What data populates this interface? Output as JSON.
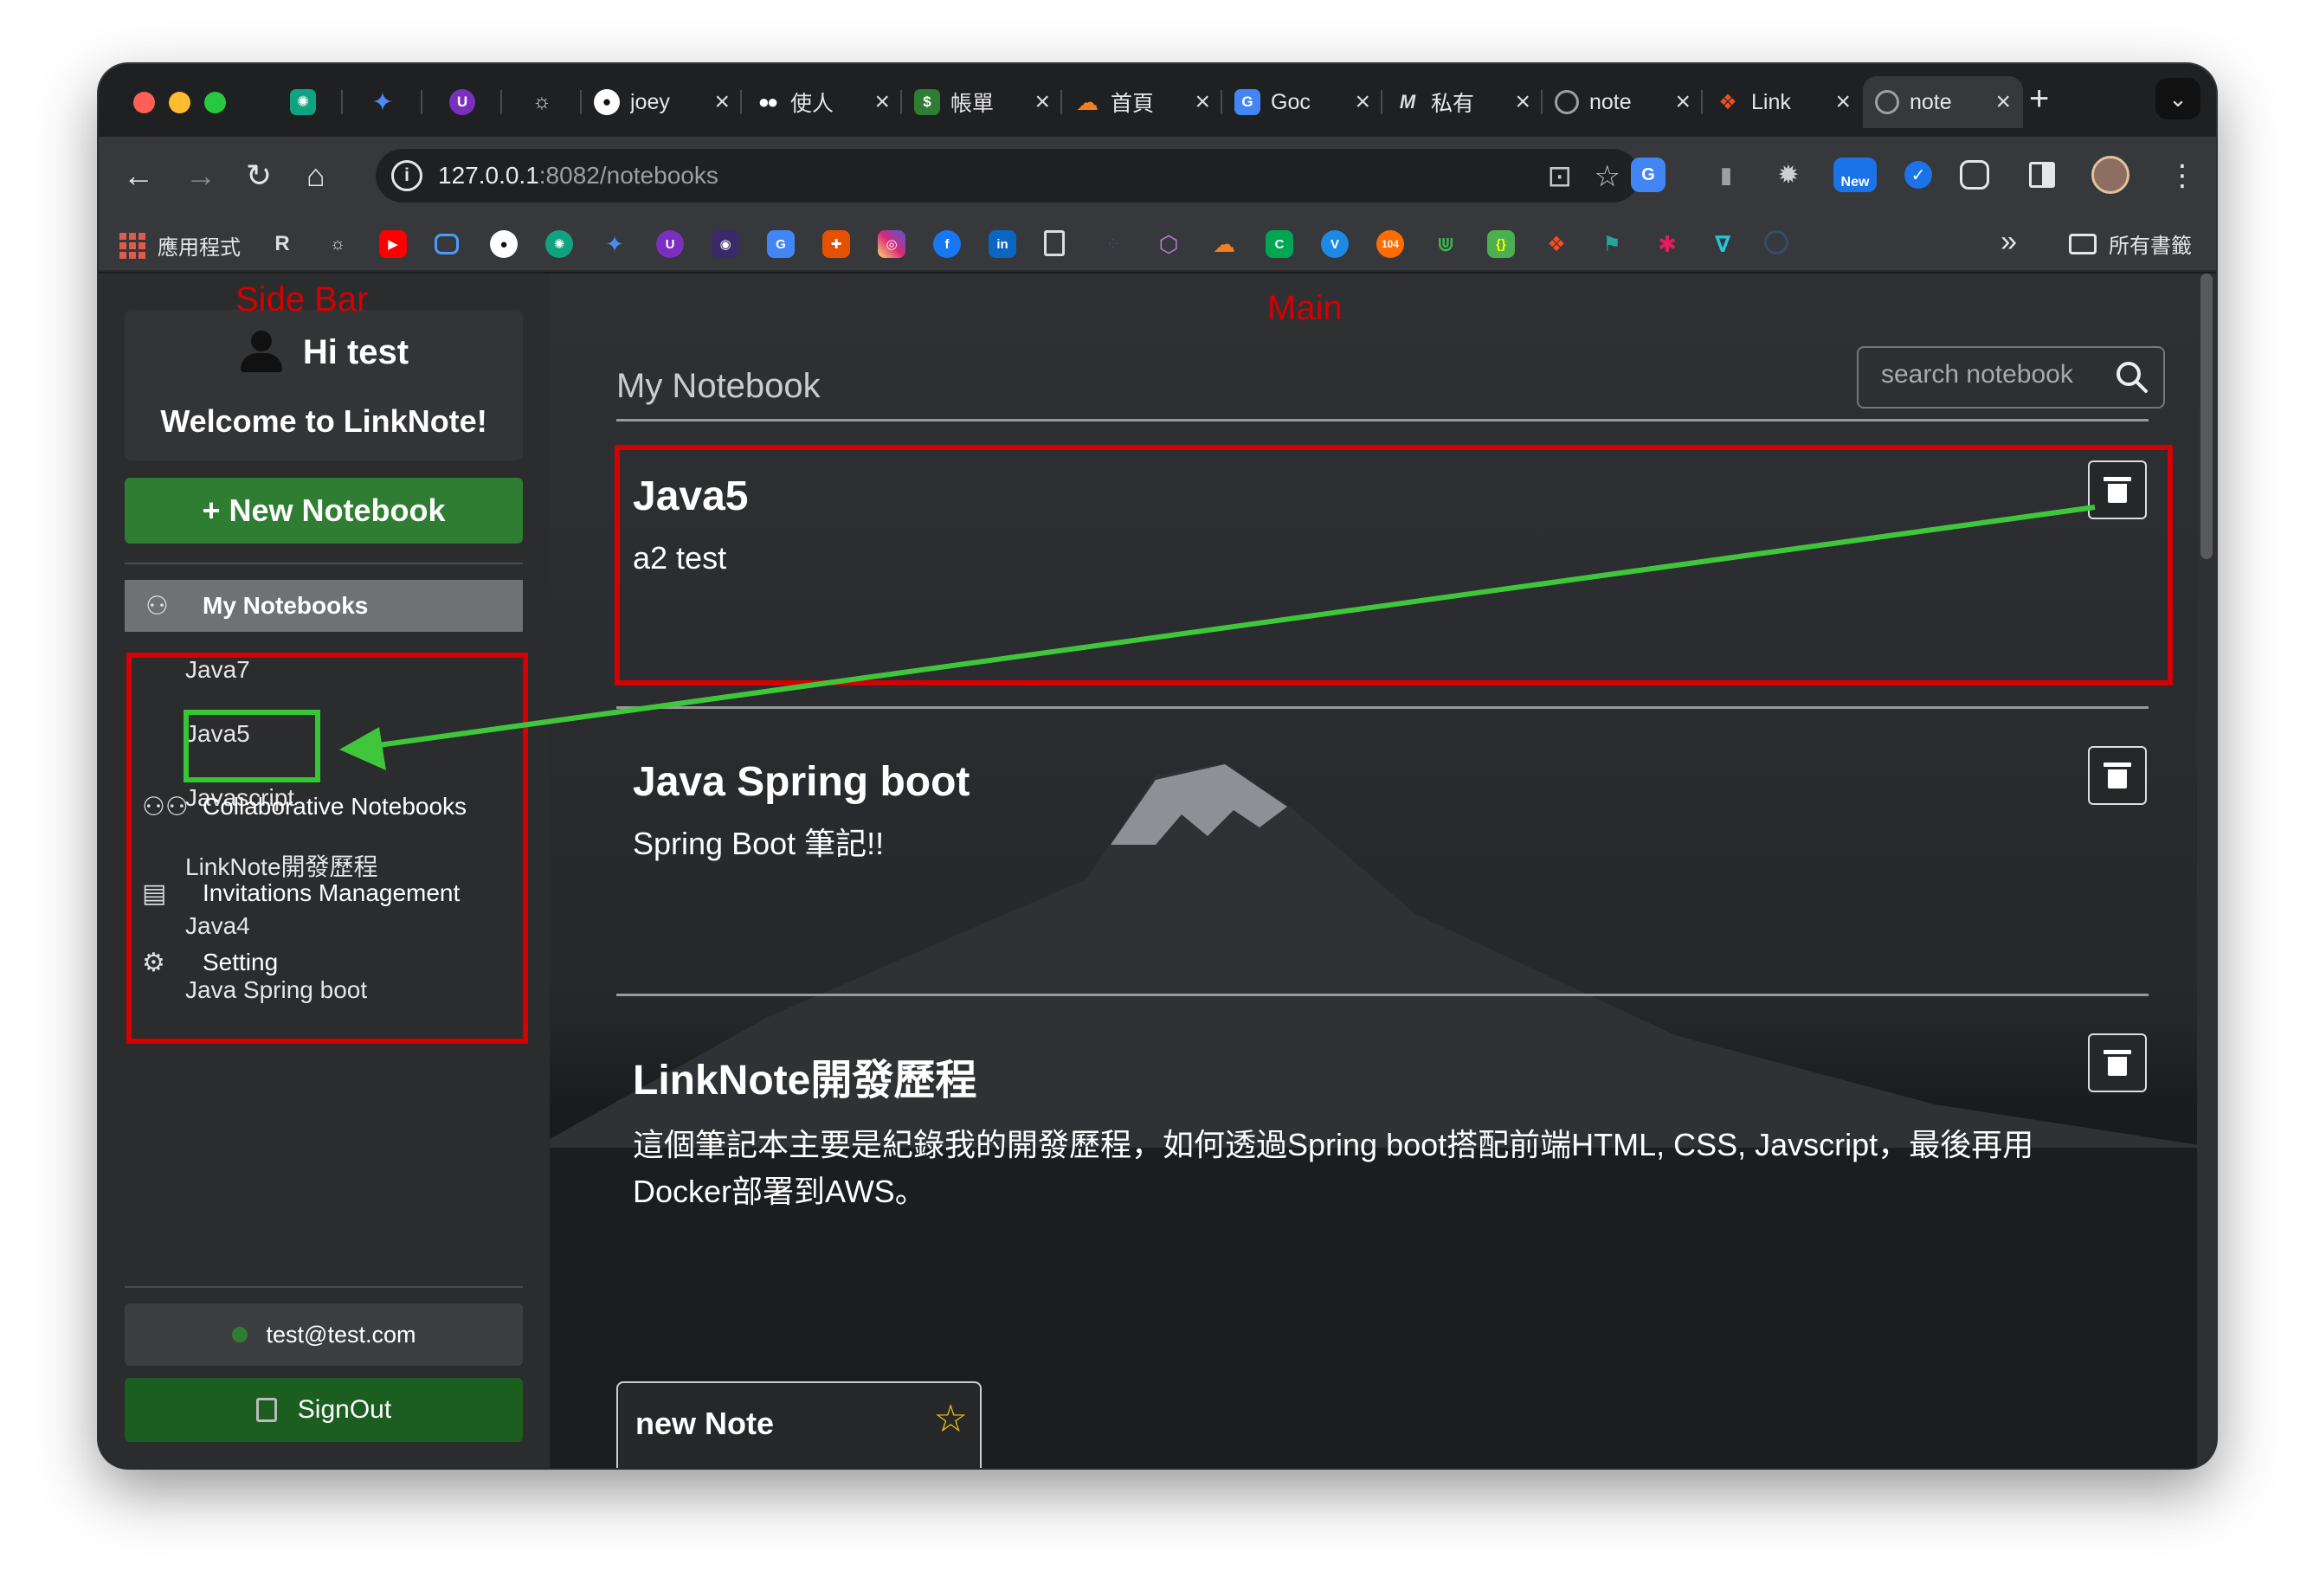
{
  "browser": {
    "pinned_tabs": [
      {
        "icon": "chatgpt-icon",
        "color": "#10a37f"
      },
      {
        "icon": "gemini-icon",
        "color": "#4285f4"
      },
      {
        "icon": "ublock-icon",
        "color": "#7b2fbf"
      },
      {
        "icon": "settings-icon",
        "color": "#3c3c3c"
      }
    ],
    "tabs": [
      {
        "title": "joey",
        "icon": "github-icon",
        "color": "#ffffff",
        "active": false
      },
      {
        "title": "使人",
        "icon": "medium-icon",
        "color": "#ffffff",
        "active": false
      },
      {
        "title": "帳單",
        "icon": "receipt-icon",
        "color": "#2e7d32",
        "active": false
      },
      {
        "title": "首頁",
        "icon": "cloudflare-icon",
        "color": "#f38020",
        "active": false
      },
      {
        "title": "Goc",
        "icon": "translate-icon",
        "color": "#4285f4",
        "active": false
      },
      {
        "title": "私有",
        "icon": "m-icon",
        "color": "#dddddd",
        "active": false
      },
      {
        "title": "note",
        "icon": "globe-icon",
        "color": "#9aa0a6",
        "active": false
      },
      {
        "title": "Link",
        "icon": "figma-icon",
        "color": "#f24e1e",
        "active": false
      },
      {
        "title": "note",
        "icon": "globe-icon",
        "color": "#9aa0a6",
        "active": true
      }
    ],
    "url_host": "127.0.0.1",
    "url_path": ":8082/notebooks",
    "bookmarks": {
      "apps_label": "應用程式",
      "folder_label": "所有書籤"
    },
    "extensions": [
      {
        "icon": "translate-ext-icon",
        "color": "#4285f4"
      },
      {
        "icon": "mouse-ext-icon",
        "color": "#5f6368"
      },
      {
        "icon": "gear-ext-icon",
        "color": "#5f6368"
      },
      {
        "icon": "new-ext-icon",
        "color": "#1a73e8",
        "label": "New"
      },
      {
        "icon": "check-ext-icon",
        "color": "#1a73e8"
      },
      {
        "icon": "puzzle-icon",
        "color": "#36383b"
      }
    ]
  },
  "annotations": {
    "sidebar": "Side Bar",
    "main": "Main"
  },
  "sidebar": {
    "greeting": "Hi test",
    "welcome": "Welcome to LinkNote!",
    "new_notebook": "+ New Notebook",
    "my_notebooks": "My Notebooks",
    "notebooks": [
      "Java7",
      "Java5",
      "Javascript",
      "LinkNote開發歷程",
      "Java4",
      "Java Spring boot"
    ],
    "collaborative": "Collaborative Notebooks",
    "invitations": "Invitations Management",
    "setting": "Setting",
    "email": "test@test.com",
    "signout": "SignOut"
  },
  "main": {
    "title": "My Notebook",
    "search_placeholder": "search notebook",
    "notebooks": [
      {
        "name": "Java5",
        "description": "a2 test"
      },
      {
        "name": "Java Spring boot",
        "description": "Spring Boot 筆記!!"
      },
      {
        "name": "LinkNote開發歷程",
        "description": "這個筆記本主要是紀錄我的開發歷程，如何透過Spring boot搭配前端HTML, CSS, Javscript，最後再用Docker部署到AWS。"
      }
    ],
    "note_card": {
      "title": "new Note"
    }
  }
}
